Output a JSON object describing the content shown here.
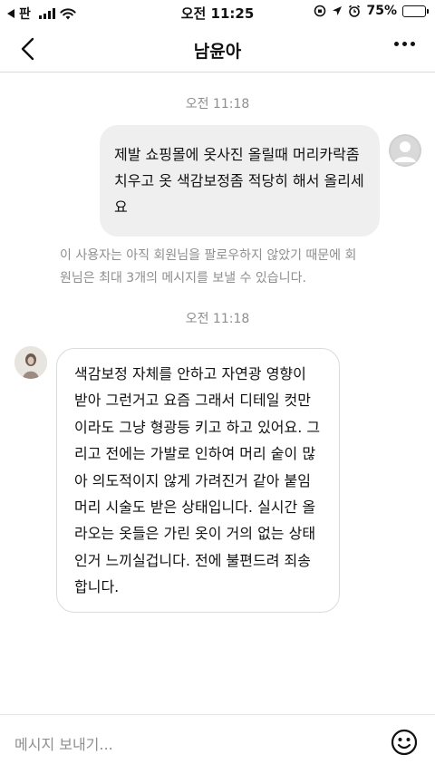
{
  "status_bar": {
    "back_app": "판",
    "time": "오전 11:25",
    "battery": "75%",
    "battery_level": 0.75
  },
  "header": {
    "title": "남윤아"
  },
  "chat": {
    "timestamp_1": "오전 11:18",
    "outgoing_message": "제발 쇼핑몰에 옷사진 올릴때 머리카락좀 치우고 옷 색감보정좀 적당히 해서  올리세요",
    "notice": "이 사용자는 아직 회원님을 팔로우하지 않았기 때문에 회원님은 최대 3개의 메시지를 보낼 수 있습니다.",
    "timestamp_2": "오전 11:18",
    "incoming_message": "색감보정 자체를 안하고 자연광 영향이 받아 그런거고 요즘 그래서 디테일 컷만이라도 그냥 형광등 키고 하고 있어요. 그리고 전에는 가발로 인하여 머리 숱이 많아 의도적이지 않게 가려진거 같아 붙임머리 시술도 받은 상태입니다. 실시간 올라오는 옷들은 가린 옷이 거의 없는 상태인거 느끼실겁니다. 전에 불편드려 죄송합니다."
  },
  "composer": {
    "placeholder": "메시지 보내기..."
  }
}
